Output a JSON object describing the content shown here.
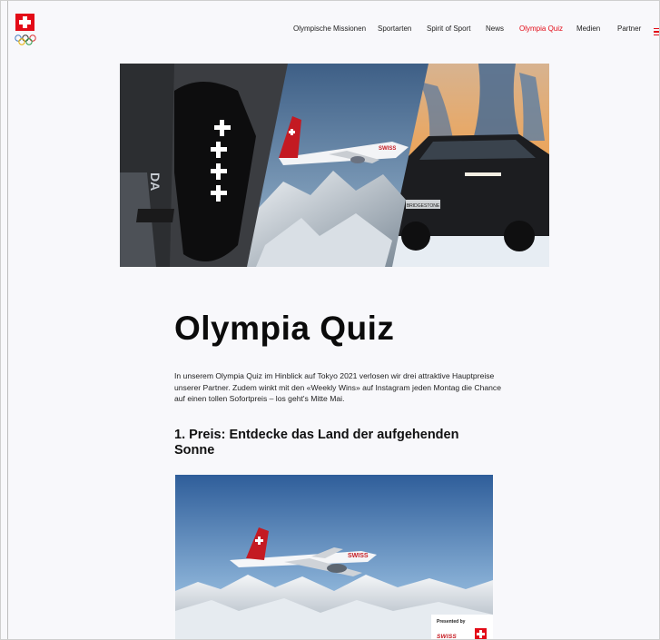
{
  "header": {
    "nav": [
      {
        "label": "Olympische Missionen",
        "active": false
      },
      {
        "label": "Sportarten",
        "active": false
      },
      {
        "label": "Spirit of Sport",
        "active": false
      },
      {
        "label": "News",
        "active": false
      },
      {
        "label": "Olympia Quiz",
        "active": true
      },
      {
        "label": "Medien",
        "active": false
      },
      {
        "label": "Partner",
        "active": false
      }
    ],
    "logo_icon": "swiss-olympic-logo",
    "menu_icon": "hamburger-menu-icon"
  },
  "hero": {
    "panels": [
      "athlete-shoulder-swiss-crosses",
      "swiss-airplane-over-alps",
      "toyota-suv-in-snow"
    ],
    "plane_livery_text": "SWISS",
    "car_plate_text": "BRIDGESTONE"
  },
  "article": {
    "title": "Olympia Quiz",
    "intro": "In unserem Olympia Quiz im Hinblick auf Tokyo 2021 verlosen wir drei attraktive Hauptpreise unserer Partner. Zudem winkt mit den «Weekly Wins» auf Instagram jeden Montag die Chance auf einen tollen Sofortpreis – los geht's Mitte Mai.",
    "prize_heading": "1. Preis: Entdecke das Land der aufgehenden Sonne",
    "prize_image": "swiss-airplane-over-alps",
    "sponsor_label": "Presented by",
    "sponsor_name": "SWISS"
  },
  "colors": {
    "accent": "#e30b17",
    "background": "#f8f8fb",
    "text": "#111111"
  }
}
